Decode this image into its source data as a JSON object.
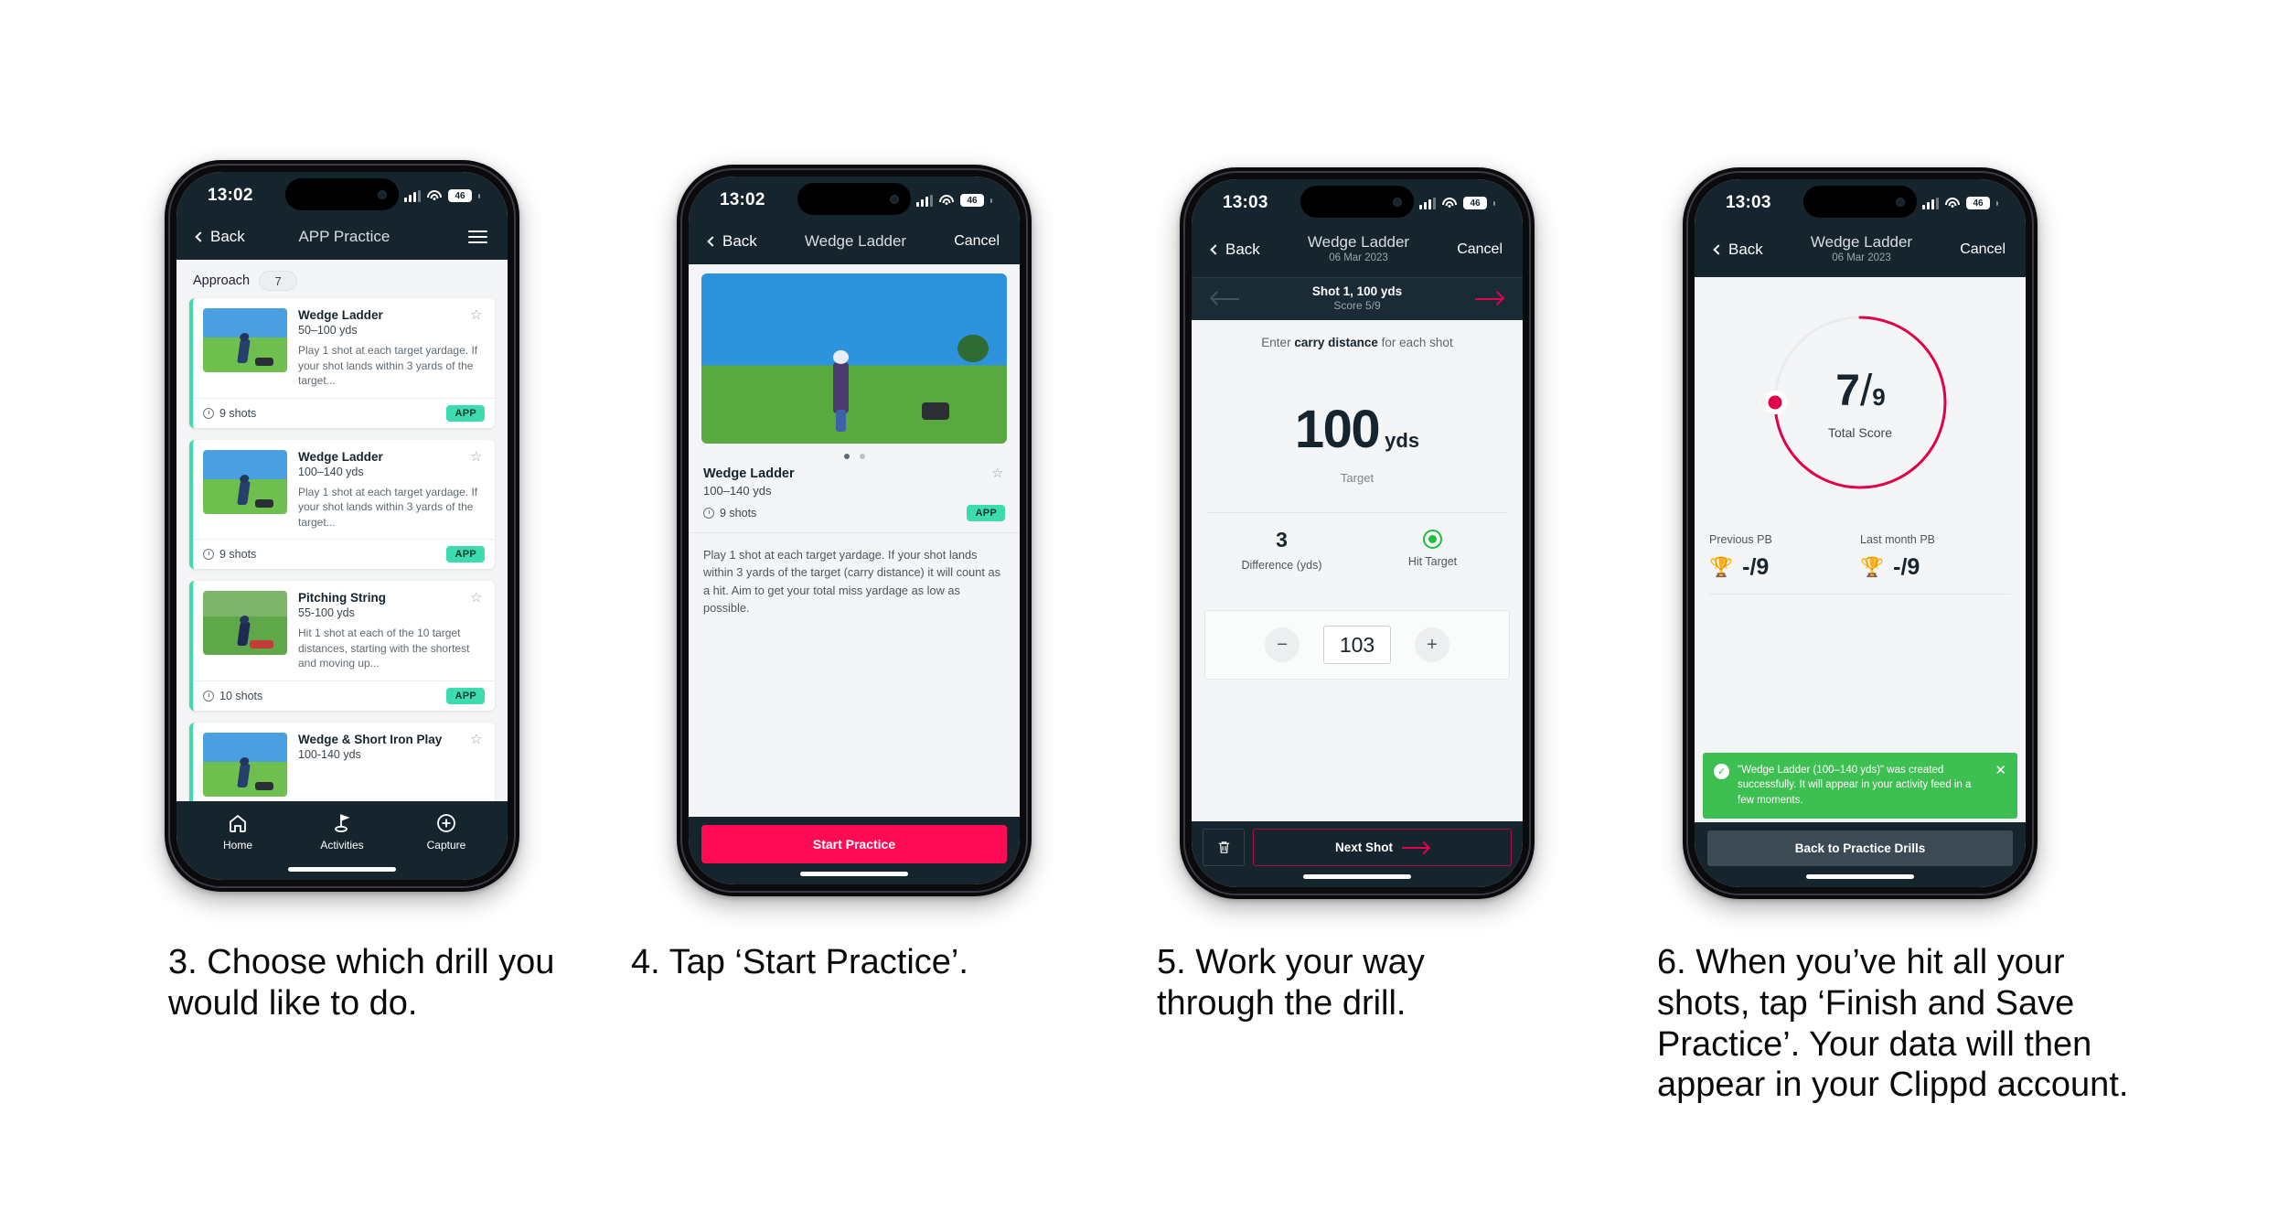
{
  "colors": {
    "nav_dark": "#16242e",
    "accent_pink": "#ff0a54",
    "accent_teal": "#3ddcae",
    "toast_green": "#3dbf51",
    "hit_green": "#1fbf3f"
  },
  "phones": [
    {
      "status": {
        "time": "13:02",
        "battery": "46"
      },
      "nav": {
        "back": "Back",
        "title": "APP Practice",
        "menu_icon": "hamburger-icon"
      },
      "section": {
        "label": "Approach",
        "count": "7"
      },
      "cards": [
        {
          "title": "Wedge Ladder",
          "range": "50–100 yds",
          "desc": "Play 1 shot at each target yardage. If your shot lands within 3 yards of the target...",
          "shots": "9 shots",
          "tag": "APP"
        },
        {
          "title": "Wedge Ladder",
          "range": "100–140 yds",
          "desc": "Play 1 shot at each target yardage. If your shot lands within 3 yards of the target...",
          "shots": "9 shots",
          "tag": "APP"
        },
        {
          "title": "Pitching String",
          "range": "55-100 yds",
          "desc": "Hit 1 shot at each of the 10 target distances, starting with the shortest and moving up...",
          "shots": "10 shots",
          "tag": "APP"
        },
        {
          "title": "Wedge & Short Iron Play",
          "range": "100-140 yds",
          "desc": "",
          "shots": "",
          "tag": ""
        }
      ],
      "tabs": [
        {
          "label": "Home",
          "icon": "home-icon"
        },
        {
          "label": "Activities",
          "icon": "golf-flag-icon"
        },
        {
          "label": "Capture",
          "icon": "plus-circle-icon"
        }
      ]
    },
    {
      "status": {
        "time": "13:02",
        "battery": "46"
      },
      "nav": {
        "back": "Back",
        "title": "Wedge Ladder",
        "cancel": "Cancel"
      },
      "detail": {
        "title": "Wedge Ladder",
        "range": "100–140 yds",
        "shots": "9 shots",
        "tag": "APP",
        "description": "Play 1 shot at each target yardage. If your shot lands within 3 yards of the target (carry distance) it will count as a hit. Aim to get your total miss yardage as low as possible."
      },
      "cta": "Start Practice"
    },
    {
      "status": {
        "time": "13:03",
        "battery": "46"
      },
      "nav": {
        "back": "Back",
        "title": "Wedge Ladder",
        "subtitle": "06 Mar 2023",
        "cancel": "Cancel"
      },
      "shotbar": {
        "title": "Shot 1, 100 yds",
        "score": "Score 5/9"
      },
      "entry": {
        "hint_pre": "Enter ",
        "hint_bold": "carry distance",
        "hint_post": " for each shot",
        "target_value": "100",
        "target_unit": "yds",
        "target_label": "Target",
        "difference_value": "3",
        "difference_label": "Difference (yds)",
        "hit_label": "Hit Target",
        "stepper_minus": "−",
        "stepper_value": "103",
        "stepper_plus": "+"
      },
      "footer": {
        "delete_icon": "trash-icon",
        "next": "Next Shot"
      }
    },
    {
      "status": {
        "time": "13:03",
        "battery": "46"
      },
      "nav": {
        "back": "Back",
        "title": "Wedge Ladder",
        "subtitle": "06 Mar 2023",
        "cancel": "Cancel"
      },
      "result": {
        "score_num": "7",
        "score_den": "9",
        "score_label": "Total Score",
        "pb": [
          {
            "title": "Previous PB",
            "value": "-/9",
            "icon": "trophy-icon"
          },
          {
            "title": "Last month PB",
            "value": "-/9",
            "icon": "trophy-icon"
          }
        ],
        "toast": {
          "message": "\"Wedge Ladder (100–140 yds)\" was created successfully. It will appear in your activity feed in a few moments.",
          "check_icon": "check-circle-icon",
          "close_icon": "close-icon"
        },
        "cta": "Back to Practice Drills"
      }
    }
  ],
  "captions": [
    "3. Choose which drill you would like to do.",
    "4. Tap ‘Start Practice’.",
    "5. Work your way through the drill.",
    "6. When you’ve hit all your shots, tap ‘Finish and Save Practice’. Your data will then appear in your Clippd account."
  ]
}
